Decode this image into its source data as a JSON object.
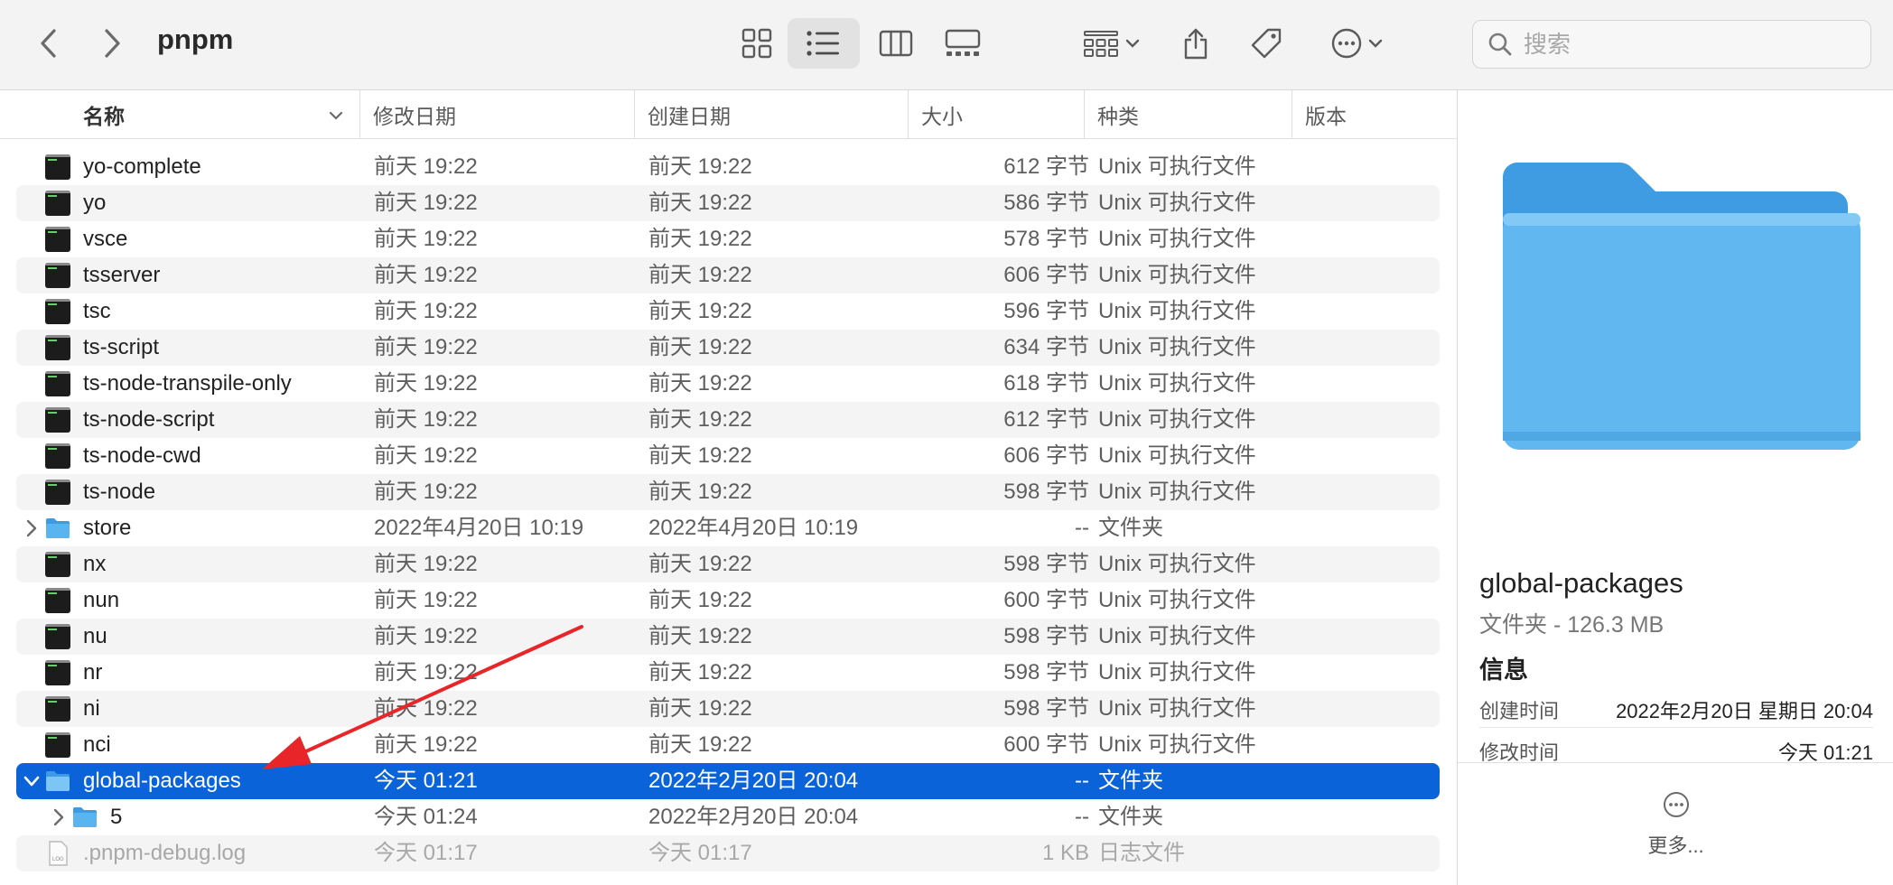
{
  "window": {
    "title": "pnpm"
  },
  "toolbar": {
    "search_placeholder": "搜索"
  },
  "columns": {
    "name": "名称",
    "modified": "修改日期",
    "created": "创建日期",
    "size": "大小",
    "kind": "种类",
    "version": "版本"
  },
  "rows": [
    {
      "name": "yo-complete",
      "modified": "前天 19:22",
      "created": "前天 19:22",
      "size": "612 字节",
      "kind": "Unix 可执行文件"
    },
    {
      "name": "yo",
      "modified": "前天 19:22",
      "created": "前天 19:22",
      "size": "586 字节",
      "kind": "Unix 可执行文件"
    },
    {
      "name": "vsce",
      "modified": "前天 19:22",
      "created": "前天 19:22",
      "size": "578 字节",
      "kind": "Unix 可执行文件"
    },
    {
      "name": "tsserver",
      "modified": "前天 19:22",
      "created": "前天 19:22",
      "size": "606 字节",
      "kind": "Unix 可执行文件"
    },
    {
      "name": "tsc",
      "modified": "前天 19:22",
      "created": "前天 19:22",
      "size": "596 字节",
      "kind": "Unix 可执行文件"
    },
    {
      "name": "ts-script",
      "modified": "前天 19:22",
      "created": "前天 19:22",
      "size": "634 字节",
      "kind": "Unix 可执行文件"
    },
    {
      "name": "ts-node-transpile-only",
      "modified": "前天 19:22",
      "created": "前天 19:22",
      "size": "618 字节",
      "kind": "Unix 可执行文件"
    },
    {
      "name": "ts-node-script",
      "modified": "前天 19:22",
      "created": "前天 19:22",
      "size": "612 字节",
      "kind": "Unix 可执行文件"
    },
    {
      "name": "ts-node-cwd",
      "modified": "前天 19:22",
      "created": "前天 19:22",
      "size": "606 字节",
      "kind": "Unix 可执行文件"
    },
    {
      "name": "ts-node",
      "modified": "前天 19:22",
      "created": "前天 19:22",
      "size": "598 字节",
      "kind": "Unix 可执行文件"
    },
    {
      "name": "store",
      "modified": "2022年4月20日 10:19",
      "created": "2022年4月20日 10:19",
      "size": "--",
      "kind": "文件夹"
    },
    {
      "name": "nx",
      "modified": "前天 19:22",
      "created": "前天 19:22",
      "size": "598 字节",
      "kind": "Unix 可执行文件"
    },
    {
      "name": "nun",
      "modified": "前天 19:22",
      "created": "前天 19:22",
      "size": "600 字节",
      "kind": "Unix 可执行文件"
    },
    {
      "name": "nu",
      "modified": "前天 19:22",
      "created": "前天 19:22",
      "size": "598 字节",
      "kind": "Unix 可执行文件"
    },
    {
      "name": "nr",
      "modified": "前天 19:22",
      "created": "前天 19:22",
      "size": "598 字节",
      "kind": "Unix 可执行文件"
    },
    {
      "name": "ni",
      "modified": "前天 19:22",
      "created": "前天 19:22",
      "size": "598 字节",
      "kind": "Unix 可执行文件"
    },
    {
      "name": "nci",
      "modified": "前天 19:22",
      "created": "前天 19:22",
      "size": "600 字节",
      "kind": "Unix 可执行文件"
    },
    {
      "name": "global-packages",
      "modified": "今天 01:21",
      "created": "2022年2月20日 20:04",
      "size": "--",
      "kind": "文件夹"
    },
    {
      "name": "5",
      "modified": "今天 01:24",
      "created": "2022年2月20日 20:04",
      "size": "--",
      "kind": "文件夹"
    },
    {
      "name": ".pnpm-debug.log",
      "modified": "今天 01:17",
      "created": "今天 01:17",
      "size": "1 KB",
      "kind": "日志文件"
    }
  ],
  "preview": {
    "name": "global-packages",
    "subtitle": "文件夹 - 126.3 MB",
    "info_heading": "信息",
    "created_label": "创建时间",
    "created_value": "2022年2月20日 星期日 20:04",
    "modified_label": "修改时间",
    "modified_value": "今天 01:21",
    "more_label": "更多..."
  },
  "colors": {
    "selection": "#0a63d9",
    "folder": "#5ab4f0",
    "annotation_arrow": "#e8262a"
  },
  "icons": {
    "back": "chevron-left-icon",
    "forward": "chevron-right-icon",
    "icon_view": "grid-icon",
    "list_view": "list-icon",
    "column_view": "columns-icon",
    "gallery_view": "gallery-icon",
    "group": "group-icon",
    "share": "share-icon",
    "tag": "tag-icon",
    "more": "ellipsis-circle-icon",
    "search": "magnifier-icon"
  }
}
